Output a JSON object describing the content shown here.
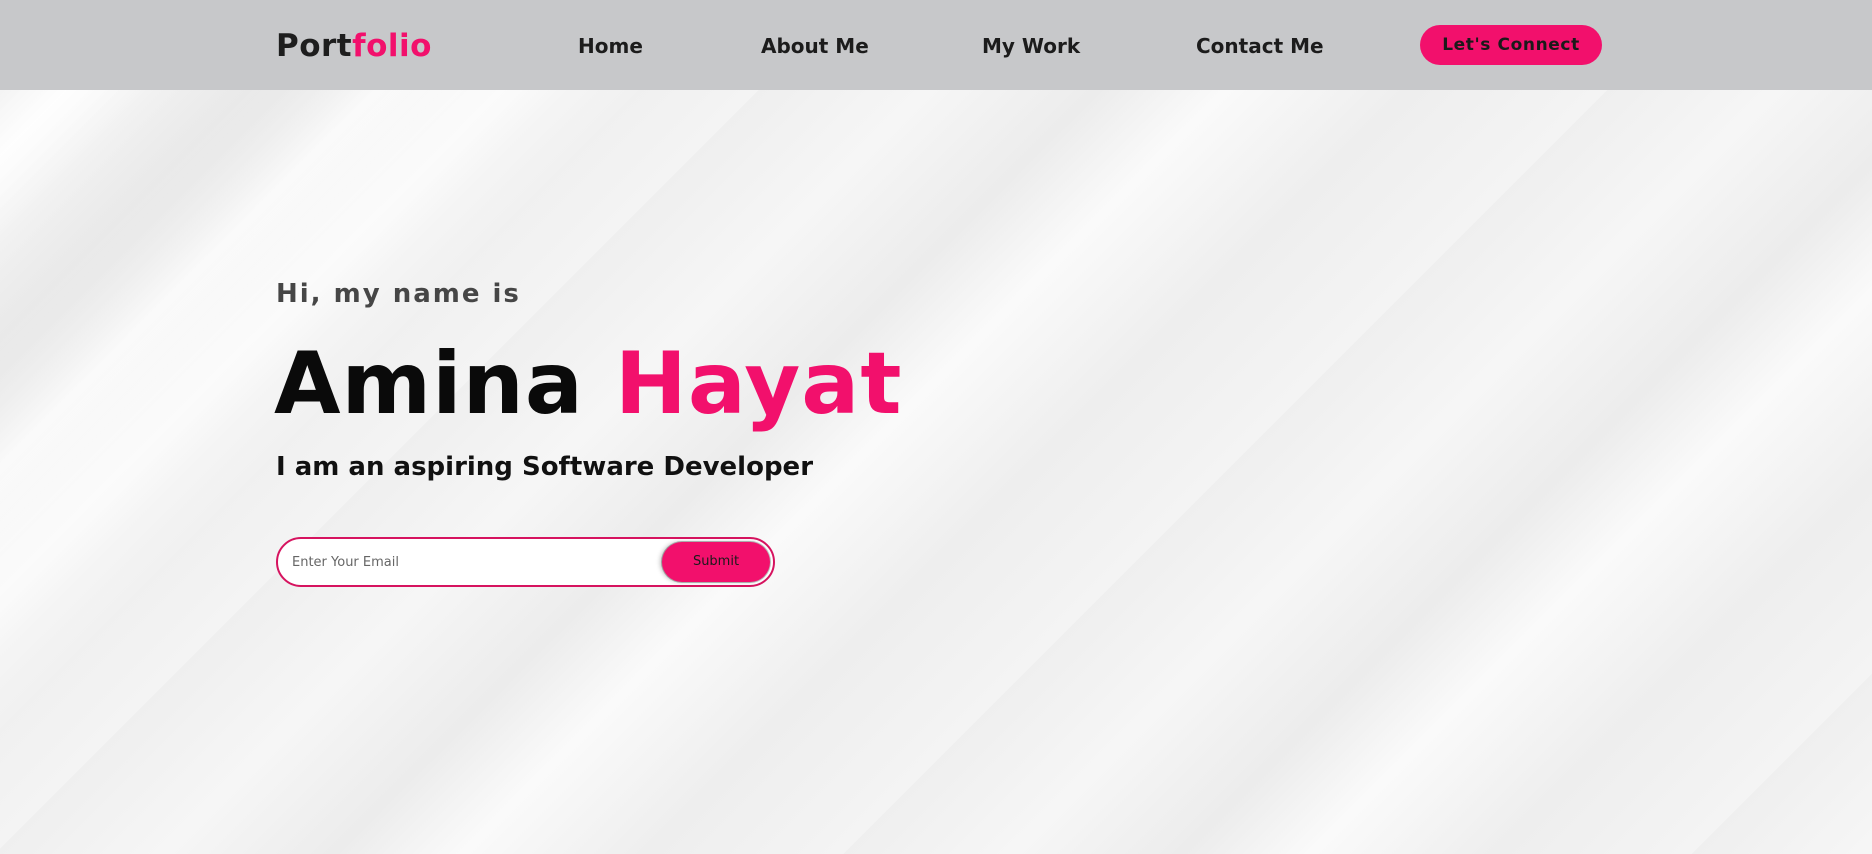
{
  "logo": {
    "part1": "Port",
    "part2": "folio"
  },
  "nav": {
    "home": "Home",
    "about": "About Me",
    "work": "My Work",
    "contact": "Contact Me",
    "cta": "Let's Connect"
  },
  "hero": {
    "greeting": "Hi, my name is",
    "first_name": "Amina",
    "last_name": "Hayat",
    "tagline": "I am an aspiring Software Developer"
  },
  "form": {
    "placeholder": "Enter Your Email",
    "submit_label": "Submit"
  },
  "colors": {
    "accent": "#f2106c",
    "navbar": "#c7c8ca",
    "text_dark": "#0a0a0a"
  }
}
